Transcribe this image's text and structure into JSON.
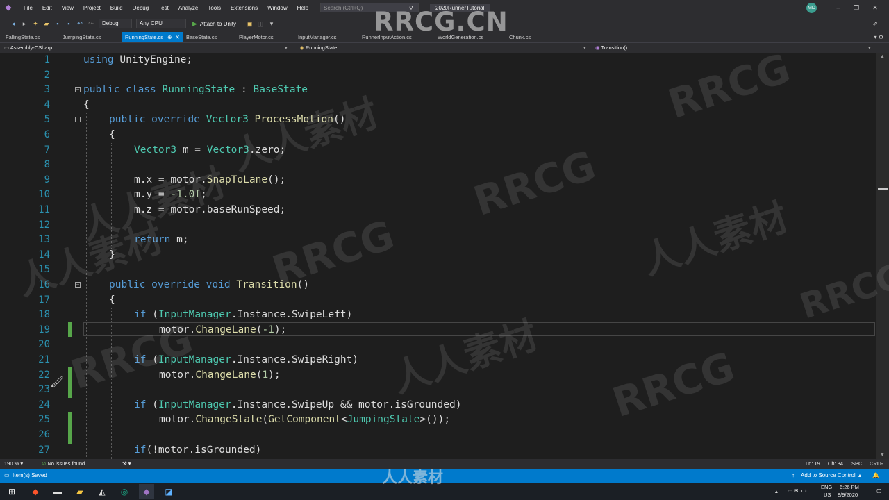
{
  "menu": {
    "items": [
      "File",
      "Edit",
      "View",
      "Project",
      "Build",
      "Debug",
      "Test",
      "Analyze",
      "Tools",
      "Extensions",
      "Window",
      "Help"
    ],
    "search_placeholder": "Search (Ctrl+Q)",
    "solution_name": "2020RunnerTutorial",
    "user_initials": "MD"
  },
  "toolbar": {
    "configuration": "Debug",
    "platform": "Any CPU",
    "attach_label": "Attach to Unity"
  },
  "tabs": [
    {
      "label": "FallingState.cs"
    },
    {
      "label": "JumpingState.cs"
    },
    {
      "label": "RunningState.cs"
    },
    {
      "label": "BaseState.cs"
    },
    {
      "label": "PlayerMotor.cs"
    },
    {
      "label": "InputManager.cs"
    },
    {
      "label": "RunnerInputAction.cs"
    },
    {
      "label": "WorldGeneration.cs"
    },
    {
      "label": "Chunk.cs"
    }
  ],
  "navbar": {
    "project": "Assembly-CSharp",
    "class": "RunningState",
    "member": "Transition()"
  },
  "code_lines": [
    "1",
    "2",
    "3",
    "4",
    "5",
    "6",
    "7",
    "8",
    "9",
    "10",
    "11",
    "12",
    "13",
    "14",
    "15",
    "16",
    "17",
    "18",
    "19",
    "20",
    "21",
    "22",
    "23",
    "24",
    "25",
    "26",
    "27"
  ],
  "code": {
    "l1": [
      "using",
      " UnityEngine;"
    ],
    "l3": [
      "public class",
      " ",
      "RunningState",
      " : ",
      "BaseState"
    ],
    "l4": [
      "{"
    ],
    "l5": [
      "public override",
      " ",
      "Vector3",
      " ",
      "ProcessMotion",
      "()"
    ],
    "l6": [
      "{"
    ],
    "l7": [
      "Vector3",
      " m = ",
      "Vector3",
      ".zero;"
    ],
    "l9": [
      "m.x = motor.",
      "SnapToLane",
      "();"
    ],
    "l10": [
      "m.y = ",
      "-1.0f",
      ";"
    ],
    "l11": [
      "m.z = motor.baseRunSpeed;"
    ],
    "l13": [
      "return",
      " m;"
    ],
    "l14": [
      "}"
    ],
    "l16": [
      "public override void",
      " ",
      "Transition",
      "()"
    ],
    "l17": [
      "{"
    ],
    "l18": [
      "if",
      " (",
      "InputManager",
      ".Instance.SwipeLeft)"
    ],
    "l19": [
      "motor.",
      "ChangeLane",
      "(",
      "-1",
      ");"
    ],
    "l21": [
      "if",
      " (",
      "InputManager",
      ".Instance.SwipeRight)"
    ],
    "l22": [
      "motor.",
      "ChangeLane",
      "(",
      "1",
      ");"
    ],
    "l24": [
      "if",
      " (",
      "InputManager",
      ".Instance.SwipeUp && motor.isGrounded)"
    ],
    "l25": [
      "motor.",
      "ChangeState",
      "(",
      "GetComponent",
      "<",
      "JumpingState",
      ">());"
    ],
    "l27": [
      "if",
      "(!motor.isGrounded)"
    ]
  },
  "editor_status": {
    "zoom": "190 %",
    "issues": "No issues found",
    "ln": "Ln: 19",
    "ch": "Ch: 34",
    "spc": "SPC",
    "crlf": "CRLF"
  },
  "statusbar": {
    "left": "Item(s) Saved",
    "right": "Add to Source Control"
  },
  "taskbar": {
    "lang": "ENG",
    "region": "US",
    "time": "6:26 PM",
    "date": "8/9/2020"
  },
  "watermark": {
    "header": "RRCG.CN",
    "footer": "人人素材",
    "text_a": "RRCG",
    "text_b": "人人素材"
  },
  "colors": {
    "accent": "#007acc",
    "keyword": "#569cd6",
    "type": "#4ec9b0",
    "method": "#dcdcaa",
    "number": "#b5cea8",
    "line_number": "#2b91af",
    "change_bar": "#57a64a"
  }
}
